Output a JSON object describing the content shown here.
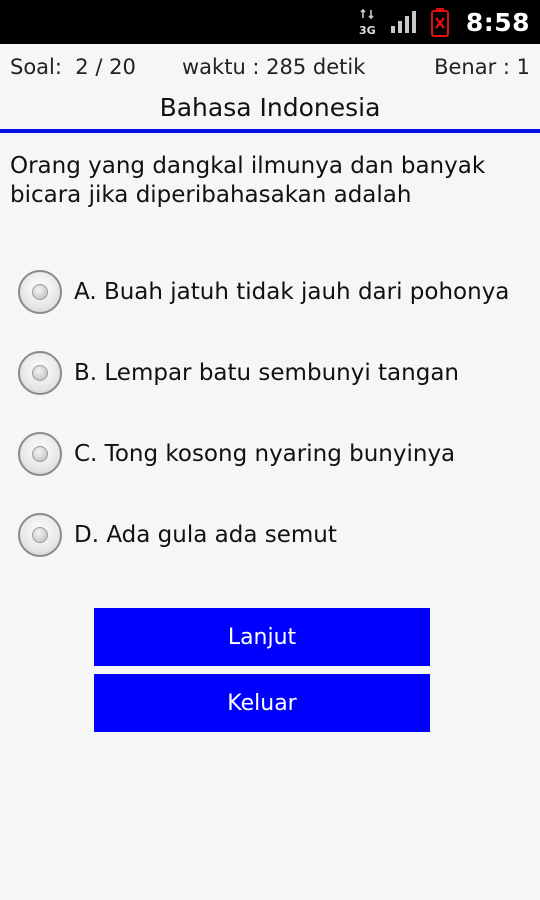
{
  "status_bar": {
    "network_label": "3G",
    "time": "8:58",
    "icons": [
      "data-3g-icon",
      "signal-bars-icon",
      "battery-alert-icon"
    ]
  },
  "info": {
    "soal_label": "Soal:  2 / 20",
    "waktu_label": "waktu : 285 detik",
    "benar_label": "Benar : 1"
  },
  "subject_title": "Bahasa Indonesia",
  "question": "Orang yang dangkal ilmunya dan banyak bicara jika diperibahasakan adalah",
  "options": [
    {
      "label": "A. Buah jatuh tidak jauh dari pohonya",
      "selected": false
    },
    {
      "label": "B. Lempar batu sembunyi tangan",
      "selected": false
    },
    {
      "label": "C. Tong kosong nyaring bunyinya",
      "selected": false
    },
    {
      "label": "D. Ada gula ada semut",
      "selected": false
    }
  ],
  "buttons": {
    "next_label": "Lanjut",
    "exit_label": "Keluar"
  },
  "colors": {
    "accent": "#0000ff",
    "rule": "#0010e8",
    "background": "#f6f6f6"
  }
}
